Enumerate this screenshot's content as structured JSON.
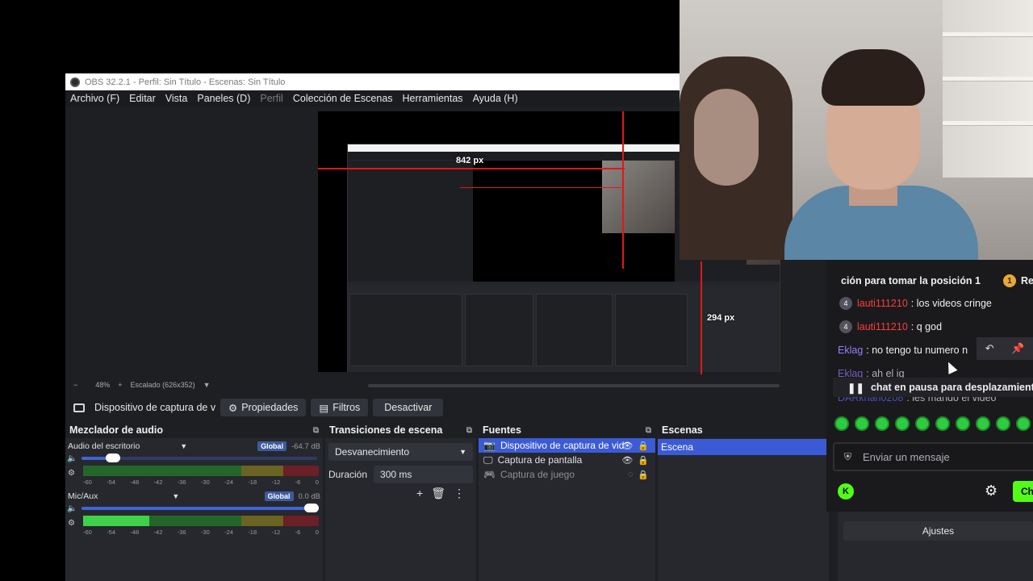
{
  "window": {
    "title": "OBS 32.2.1 - Perfil: Sin Título - Escenas: Sin Título"
  },
  "menu": [
    "Archivo (F)",
    "Editar",
    "Vista",
    "Paneles (D)",
    "Perfil",
    "Colección de Escenas",
    "Herramientas",
    "Ayuda (H)"
  ],
  "preview": {
    "label_top": "842 px",
    "label_bottom": "294 px",
    "zoom_minus": "−",
    "zoom": "48%",
    "zoom_plus": "+",
    "scale": "Escalado (626x352)"
  },
  "source_bar": {
    "source": "Dispositivo de captura de v",
    "properties": "Propiedades",
    "filters": "Filtros",
    "deactivate": "Desactivar"
  },
  "mixer": {
    "title": "Mezclador de audio",
    "channels": [
      {
        "name": "Audio del escritorio",
        "badge": "Global",
        "db": "-64.7 dB",
        "volume": 0.15,
        "level": 0.0
      },
      {
        "name": "Mic/Aux",
        "badge": "Global",
        "db": "0.0 dB",
        "volume": 1.0,
        "level": 0.28
      }
    ],
    "scale": [
      "-60",
      "-54",
      "-48",
      "-42",
      "-36",
      "-30",
      "-24",
      "-18",
      "-12",
      "-6",
      "0"
    ]
  },
  "transitions": {
    "title": "Transiciones de escena",
    "selected": "Desvanecimiento",
    "duration_label": "Duración",
    "duration_value": "300 ms"
  },
  "sources": {
    "title": "Fuentes",
    "items": [
      {
        "name": "Dispositivo de captura de vid",
        "selected": true
      },
      {
        "name": "Captura de pantalla",
        "selected": false
      },
      {
        "name": "Captura de juego",
        "selected": false
      }
    ]
  },
  "scenes": {
    "title": "Escenas",
    "items": [
      "Escena"
    ]
  },
  "chat": {
    "top": "ción para tomar la posición 1",
    "top_coin": "1",
    "top_suffix": "Re",
    "messages": [
      {
        "badge": "4",
        "user": "lauti111210",
        "text": ": los videos cringe"
      },
      {
        "badge": "4",
        "user": "lauti111210",
        "text": ": q god"
      },
      {
        "badge": "",
        "user": "Eklag",
        "text": ": no tengo tu numero n"
      },
      {
        "badge": "",
        "user": "Eklag",
        "text": ": ah el ig"
      },
      {
        "badge": "",
        "user": "DARkhan0208",
        "text": ": les mando el video"
      }
    ],
    "pause": "chat en pausa para desplazamient",
    "input_placeholder": "Enviar un mensaje",
    "send": "Ch",
    "k": "K"
  },
  "ajustes": "Ajustes",
  "colors": {
    "accent": "#3b5bd6",
    "kick_green": "#53fc18",
    "red": "#e01818"
  }
}
